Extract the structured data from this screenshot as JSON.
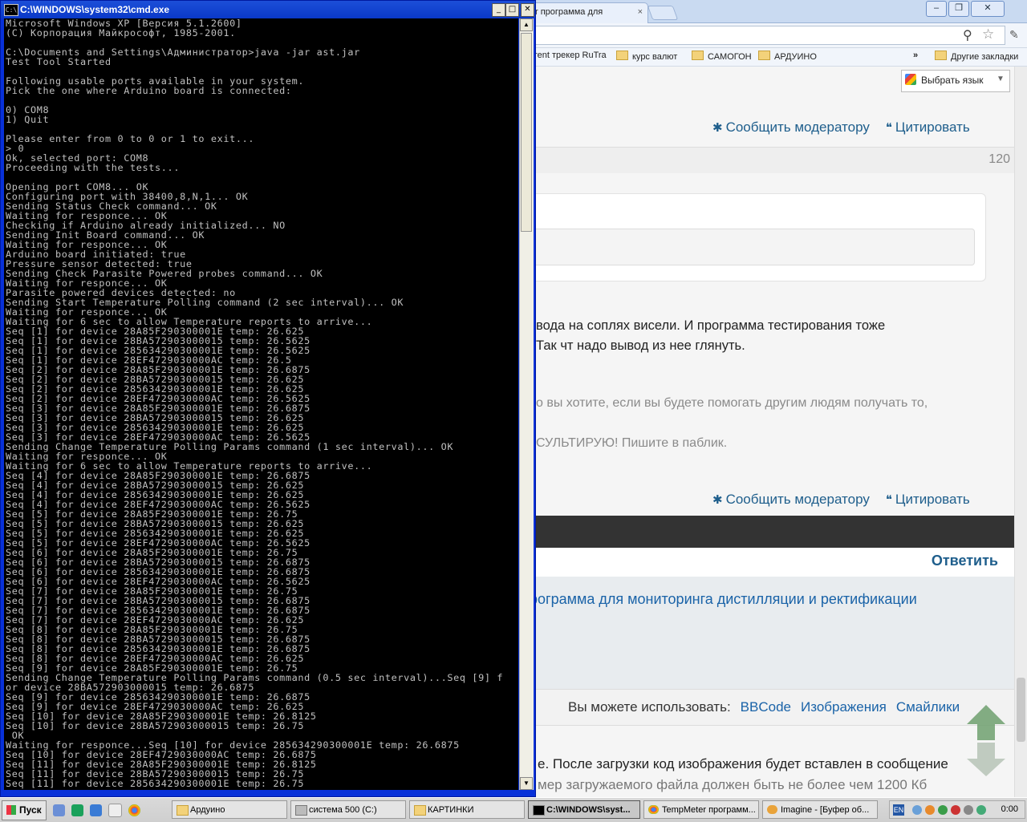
{
  "cmd": {
    "title": "C:\\WINDOWS\\system32\\cmd.exe",
    "icon": "cmd-icon",
    "icon_text": "C:\\",
    "output": "Microsoft Windows XP [Версия 5.1.2600]\n(С) Корпорация Майкрософт, 1985-2001.\n\nC:\\Documents and Settings\\Администратор>java -jar ast.jar\nTest Tool Started\n\nFollowing usable ports available in your system.\nPick the one where Arduino board is connected:\n\n0) COM8\n1) Quit\n\nPlease enter from 0 to 0 or 1 to exit...\n> 0\nOk, selected port: COM8\nProceeding with the tests...\n\nOpening port COM8... OK\nConfiguring port with 38400,8,N,1... OK\nSending Status Check command... OK\nWaiting for responce... OK\nChecking if Arduino already initialized... NO\nSending Init Board command... OK\nWaiting for responce... OK\nArduino board initiated: true\nPressure sensor detected: true\nSending Check Parasite Powered probes command... OK\nWaiting for responce... OK\nParasite powered devices detected: no\nSending Start Temperature Polling command (2 sec interval)... OK\nWaiting for responce... OK\nWaiting for 6 sec to allow Temperature reports to arrive...\nSeq [1] for device 28A85F290300001E temp: 26.625\nSeq [1] for device 28BA572903000015 temp: 26.5625\nSeq [1] for device 285634290300001E temp: 26.5625\nSeq [1] for device 28EF4729030000AC temp: 26.5\nSeq [2] for device 28A85F290300001E temp: 26.6875\nSeq [2] for device 28BA572903000015 temp: 26.625\nSeq [2] for device 285634290300001E temp: 26.625\nSeq [2] for device 28EF4729030000AC temp: 26.5625\nSeq [3] for device 28A85F290300001E temp: 26.6875\nSeq [3] for device 28BA572903000015 temp: 26.625\nSeq [3] for device 285634290300001E temp: 26.625\nSeq [3] for device 28EF4729030000AC temp: 26.5625\nSending Change Temperature Polling Params command (1 sec interval)... OK\nWaiting for responce... OK\nWaiting for 6 sec to allow Temperature reports to arrive...\nSeq [4] for device 28A85F290300001E temp: 26.6875\nSeq [4] for device 28BA572903000015 temp: 26.625\nSeq [4] for device 285634290300001E temp: 26.625\nSeq [4] for device 28EF4729030000AC temp: 26.5625\nSeq [5] for device 28A85F290300001E temp: 26.75\nSeq [5] for device 28BA572903000015 temp: 26.625\nSeq [5] for device 285634290300001E temp: 26.625\nSeq [5] for device 28EF4729030000AC temp: 26.5625\nSeq [6] for device 28A85F290300001E temp: 26.75\nSeq [6] for device 28BA572903000015 temp: 26.6875\nSeq [6] for device 285634290300001E temp: 26.6875\nSeq [6] for device 28EF4729030000AC temp: 26.5625\nSeq [7] for device 28A85F290300001E temp: 26.75\nSeq [7] for device 28BA572903000015 temp: 26.6875\nSeq [7] for device 285634290300001E temp: 26.6875\nSeq [7] for device 28EF4729030000AC temp: 26.625\nSeq [8] for device 28A85F290300001E temp: 26.75\nSeq [8] for device 28BA572903000015 temp: 26.6875\nSeq [8] for device 285634290300001E temp: 26.6875\nSeq [8] for device 28EF4729030000AC temp: 26.625\nSeq [9] for device 28A85F290300001E temp: 26.75\nSending Change Temperature Polling Params command (0.5 sec interval)...Seq [9] f\nor device 28BA572903000015 temp: 26.6875\nSeq [9] for device 285634290300001E temp: 26.6875\nSeq [9] for device 28EF4729030000AC temp: 26.625\nSeq [10] for device 28A85F290300001E temp: 26.8125\nSeq [10] for device 28BA572903000015 temp: 26.75\n OK\nWaiting for responce...Seq [10] for device 285634290300001E temp: 26.6875\nSeq [10] for device 28EF4729030000AC temp: 26.6875\nSeq [11] for device 28A85F290300001E temp: 26.8125\nSeq [11] for device 28BA572903000015 temp: 26.75\nSeq [11] for device 285634290300001E temp: 26.75"
  },
  "browser": {
    "tab_title": "r программа для",
    "bookmarks": [
      "rent трекер RuTra",
      "курс валют",
      "САМОГОН",
      "АРДУИНО"
    ],
    "bookmarks_more": "»",
    "other_bookmarks": "Другие закладки",
    "translate_label": "Выбрать язык",
    "translate_arrow": "▼",
    "report_label": "Сообщить модератору",
    "quote_label": "Цитировать",
    "post_number": "120",
    "post_line1": "вода на соплях висели. И программа тестирования тоже",
    "post_line2": "Так чт надо вывод из нее глянуть.",
    "sig_line1": "о вы хотите, если вы будете помогать другим людям получать то,",
    "sig_line2": "СУЛЬТИРУЮ! Пишите в паблик.",
    "reply_label": "Ответить",
    "topic_link": "рограмма для мониторинга дистилляции и ректификации",
    "editor_hint": "Вы можете использовать:",
    "editor_links": [
      "BBCode",
      "Изображения",
      "Смайлики"
    ],
    "upload_line1": "е. После загрузки код изображения будет вставлен в сообщение",
    "upload_line2": "мер загружаемого файла должен быть не более чем 1200 Кб"
  },
  "taskbar": {
    "start_label": "Пуск",
    "tasks": [
      {
        "label": "Ардуино",
        "icon": "folder-icon"
      },
      {
        "label": "система 500 (C:)",
        "icon": "drive-icon"
      },
      {
        "label": "КАРТИНКИ",
        "icon": "folder-icon"
      },
      {
        "label": "C:\\WINDOWS\\syst...",
        "icon": "cmd-icon",
        "active": true
      },
      {
        "label": "TempMeter программ...",
        "icon": "chrome-icon"
      },
      {
        "label": "Imagine - [Буфер об...",
        "icon": "imagine-icon"
      }
    ],
    "lang": "EN",
    "clock": "0:00"
  },
  "colors": {
    "xp_blue": "#0a39c8",
    "link_blue": "#1a63a8",
    "action_blue": "#1e5e8c",
    "console_text": "#c0c0c0"
  }
}
